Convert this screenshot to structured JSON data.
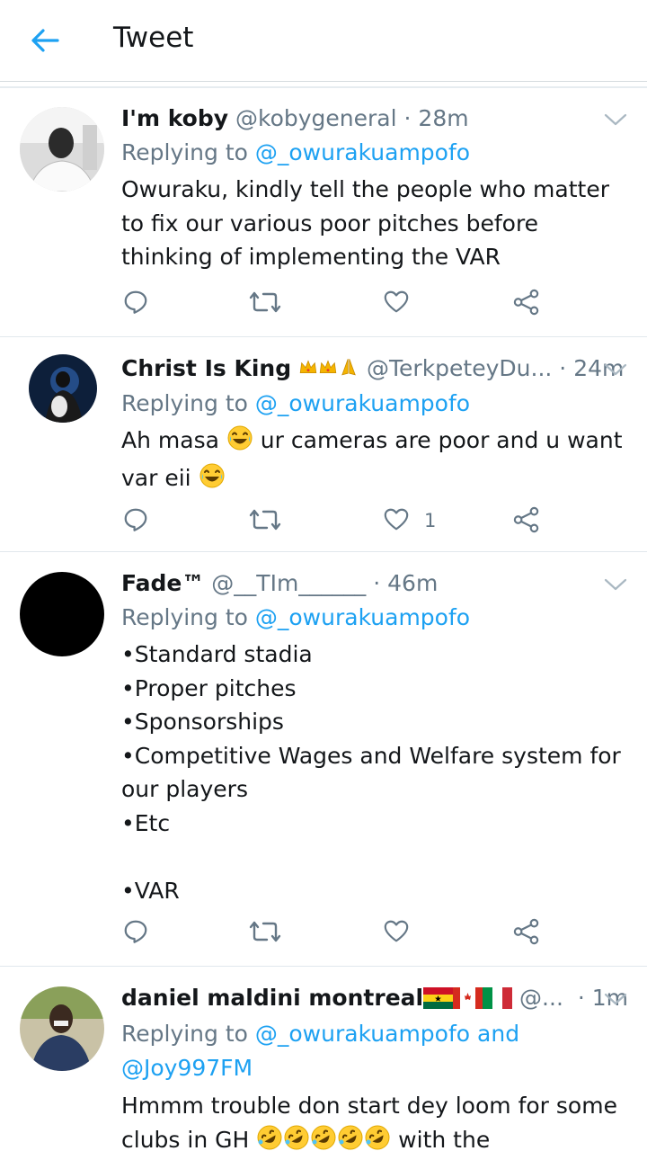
{
  "header": {
    "title": "Tweet"
  },
  "tweets": [
    {
      "name": "I'm koby",
      "handle": "@kobygeneral",
      "time": "· 28m",
      "replying_prefix": "Replying to ",
      "replying_to": "@_owurakuampofo",
      "text": "Owuraku, kindly tell the people who matter to fix our various poor pitches before thinking of implementing the VAR",
      "like_count": ""
    },
    {
      "name": "Christ Is King",
      "name_emojis": [
        "crown",
        "crown",
        "folded-hands"
      ],
      "handle": "@TerkpeteyDu...",
      "time": "· 24m",
      "replying_prefix": "Replying to ",
      "replying_to": "@_owurakuampofo",
      "text_part1": "Ah masa ",
      "text_part2": " ur cameras are poor and u want",
      "text_part3": "var eii ",
      "like_count": "1"
    },
    {
      "name": "Fade™",
      "handle": "@__TIm______",
      "time": "· 46m",
      "replying_prefix": "Replying to ",
      "replying_to": "@_owurakuampofo",
      "text": "•Standard stadia\n•Proper pitches\n•Sponsorships\n•Competitive Wages and Welfare system for our players\n•Etc\n\n•VAR",
      "like_count": ""
    },
    {
      "name": "daniel maldini montreal",
      "name_emojis": [
        "flag-ghana",
        "flag-canada",
        "flag-italy"
      ],
      "handle": "@...",
      "time": "· 1m",
      "replying_prefix": "Replying to ",
      "replying_to": "@_owurakuampofo",
      "replying_and": " and",
      "replying_to_2": "@Joy997FM",
      "text_line1": "Hmmm trouble don start dey loom for some",
      "text_line2_a": "clubs in GH ",
      "text_line2_b": " with the"
    }
  ],
  "colors": {
    "accent": "#1da1f2",
    "secondary": "#657786",
    "text": "#14171a",
    "divider": "#e1e8ed"
  }
}
